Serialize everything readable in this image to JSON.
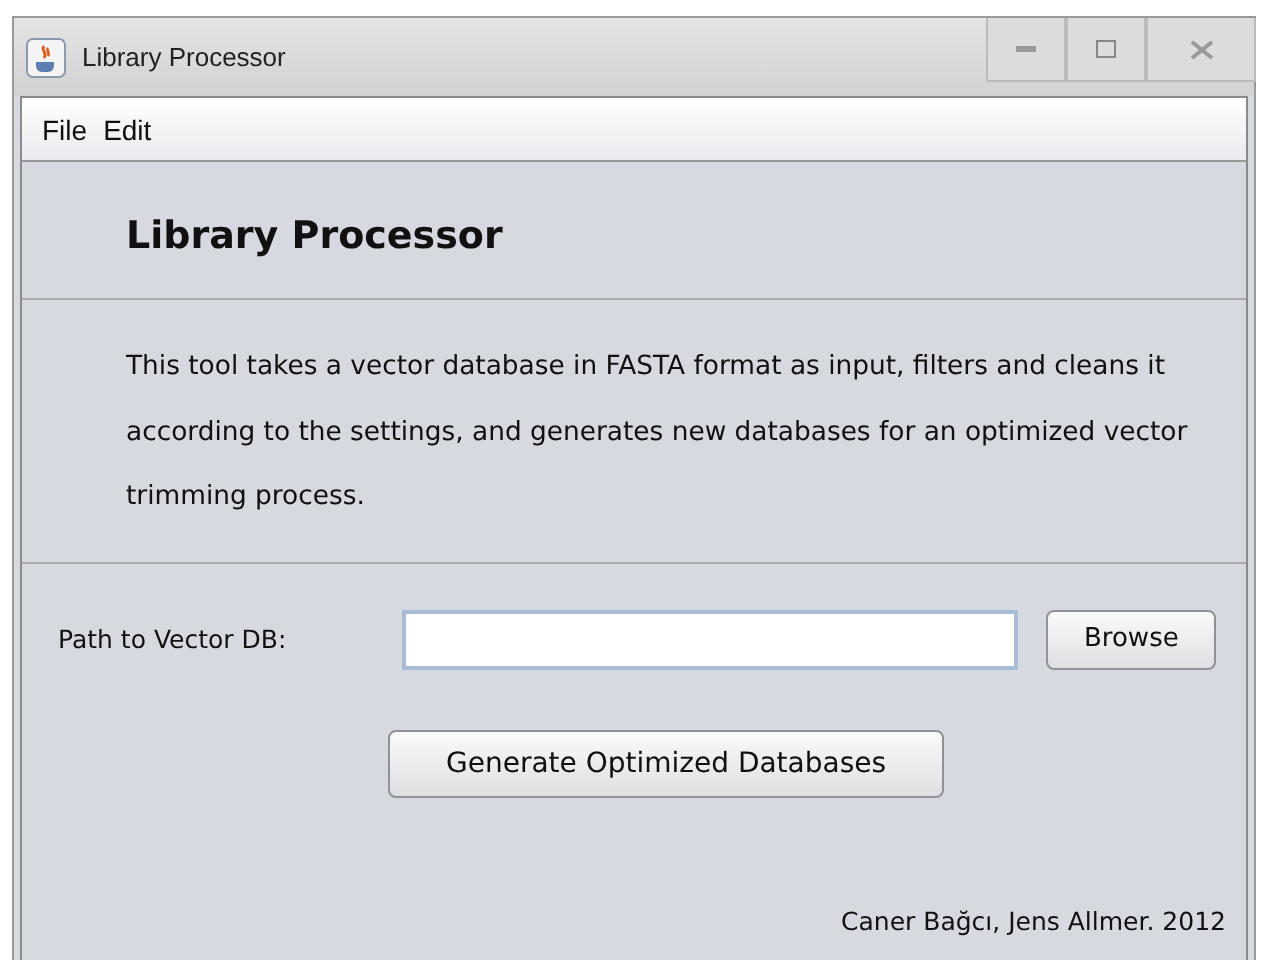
{
  "window": {
    "title": "Library Processor"
  },
  "menu": [
    "File",
    "Edit"
  ],
  "heading": "Library Processor",
  "description": "This tool takes a vector database in FASTA format as input, filters and cleans it according to the settings, and generates new databases for an optimized vector trimming process.",
  "path_field": {
    "label": "Path to Vector DB:"
  },
  "browse_button": "Browse",
  "generate_button": "Generate Optimized Databases",
  "credit": "Caner Bağcı, Jens Allmer. 2012"
}
